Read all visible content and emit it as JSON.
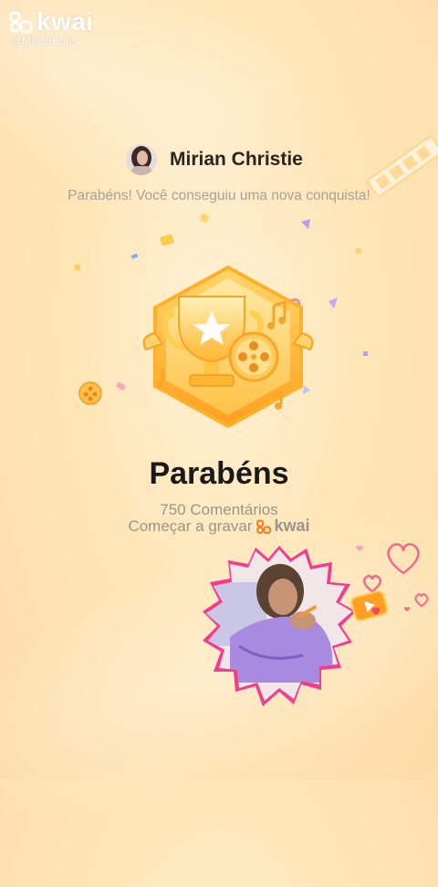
{
  "watermark": {
    "brand": "kwai",
    "handle": "@MirianChris"
  },
  "user": {
    "name": "Mirian Christie"
  },
  "subtitle": "Parabéns! Você conseguiu uma nova conquista!",
  "achievement": {
    "title": "Parabéns",
    "count": "750 Comentários",
    "record_label": "Começar a gravar",
    "record_brand": "kwai"
  },
  "colors": {
    "accent": "#ff7a1a",
    "gold": "#ffc23d",
    "title": "#1a1a1a",
    "muted": "#9a948a",
    "heart": "#f06a8c"
  },
  "icons": [
    "kwai-logo-icon",
    "trophy-medal-icon",
    "film-reel-icon",
    "heart-icon",
    "video-play-icon"
  ]
}
